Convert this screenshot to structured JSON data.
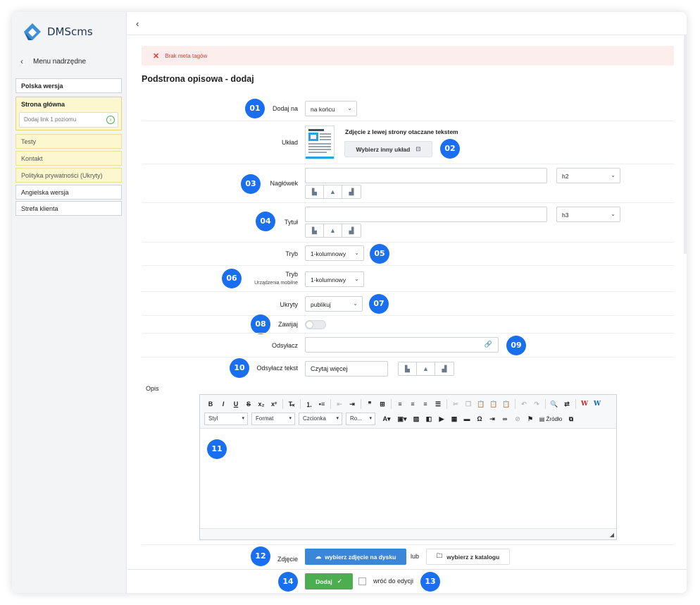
{
  "app": {
    "logo_text": "DMScms"
  },
  "sidebar": {
    "back_label": "Menu nadrzędne",
    "items": [
      {
        "label": "Polska wersja"
      },
      {
        "label": "Strona główna"
      },
      {
        "label": "Testy"
      },
      {
        "label": "Kontakt"
      },
      {
        "label": "Polityka prywatności (Ukryty)"
      },
      {
        "label": "Angielska wersja"
      },
      {
        "label": "Strefa klienta"
      }
    ],
    "add_link_placeholder": "Dodaj link 1 poziomu"
  },
  "alert": {
    "text": "Brak meta tagów"
  },
  "page": {
    "title": "Podstrona opisowa - dodaj"
  },
  "form": {
    "add_at": {
      "label": "Dodaj na",
      "value": "na końcu"
    },
    "layout": {
      "label": "Układ",
      "name": "Zdjęcie z lewej strony otaczane tekstem",
      "change_button": "Wybierz inny układ"
    },
    "heading": {
      "label": "Nagłówek",
      "value": "",
      "tag": "h2"
    },
    "title": {
      "label": "Tytuł",
      "value": "",
      "tag": "h3"
    },
    "mode": {
      "label": "Tryb",
      "value": "1-kolumnowy"
    },
    "mobile_mode": {
      "label": "Tryb",
      "sublabel": "Urządzenia mobilne",
      "value": "1-kolumnowy"
    },
    "hidden": {
      "label": "Ukryty",
      "value": "publikuj"
    },
    "collapse": {
      "label": "Zawijaj",
      "on": false
    },
    "link": {
      "label": "Odsyłacz",
      "value": ""
    },
    "link_text": {
      "label": "Odsyłacz tekst",
      "value": "Czytaj więcej"
    },
    "description": {
      "label": "Opis"
    },
    "image": {
      "label": "Zdjęcie",
      "upload_button": "wybierz zdjęcie na dysku",
      "or": "lub",
      "catalog_button": "wybierz z katalogu"
    }
  },
  "editor": {
    "combos": [
      "Styl",
      "Format",
      "Czcionka",
      "Ro..."
    ],
    "source_label": "Źródło"
  },
  "footer": {
    "submit": "Dodaj",
    "return_label": "wróć do edycji"
  },
  "badges": [
    "01",
    "02",
    "03",
    "04",
    "05",
    "06",
    "07",
    "08",
    "09",
    "10",
    "11",
    "12",
    "13",
    "14"
  ],
  "colors": {
    "accent": "#1a6ff0",
    "green": "#4cae4f",
    "blue_button": "#3c86d8",
    "alert": "#e53935"
  }
}
